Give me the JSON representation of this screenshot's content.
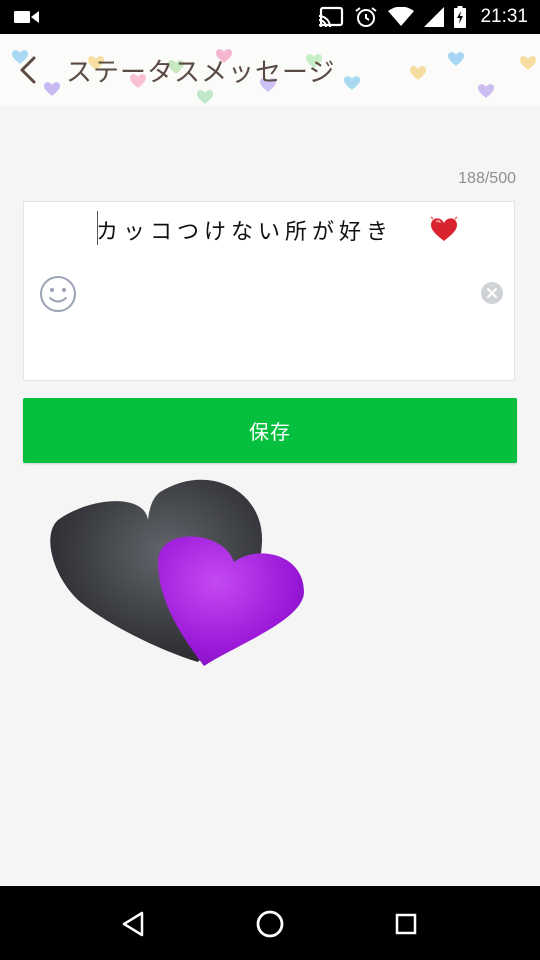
{
  "status_bar": {
    "time": "21:31",
    "icons": [
      "video-camera-icon",
      "cast-icon",
      "alarm-icon",
      "wifi-icon",
      "cell-signal-icon",
      "battery-charging-icon"
    ]
  },
  "header": {
    "title": "ステータスメッセージ",
    "back_icon": "chevron-left-icon"
  },
  "editor": {
    "char_count": "188/500",
    "status_text": "カッコつけない所が好き",
    "trailing_emoji": "red-heart-emoji",
    "emoji_button_icon": "smiley-icon",
    "clear_button_icon": "clear-circle-icon"
  },
  "save_button": {
    "label": "保存",
    "color": "#07bf3e"
  },
  "sticker": {
    "name": "black-and-purple-hearts-sticker"
  },
  "nav_bar": {
    "buttons": [
      "back-triangle-icon",
      "home-circle-icon",
      "recents-square-icon"
    ]
  }
}
